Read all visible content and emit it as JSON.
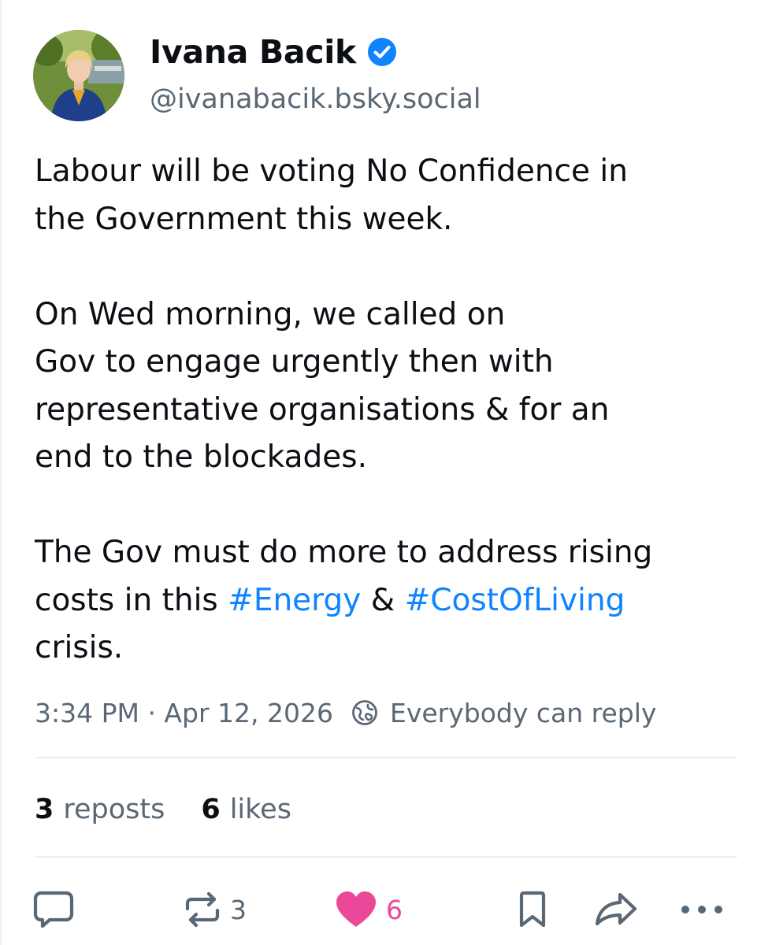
{
  "author": {
    "display_name": "Ivana Bacik",
    "handle": "@ivanabacik.bsky.social",
    "verified": true,
    "avatar_icon": "avatar-photo",
    "verified_icon": "verified-check-icon"
  },
  "post": {
    "paragraphs": [
      [
        [
          {
            "text": "Labour will be voting No Confidence in"
          }
        ],
        [
          {
            "text": "the Government this week."
          }
        ]
      ],
      [
        [
          {
            "text": "On Wed morning, we called on"
          }
        ],
        [
          {
            "text": "Gov to engage urgently then with"
          }
        ],
        [
          {
            "text": "representative organisations & for an"
          }
        ],
        [
          {
            "text": "end to the blockades."
          }
        ]
      ],
      [
        [
          {
            "text": "The Gov must do more to address rising"
          }
        ],
        [
          {
            "text": "costs in this "
          },
          {
            "text": "#Energy",
            "hashtag": true
          },
          {
            "text": " & "
          },
          {
            "text": "#CostOfLiving",
            "hashtag": true
          }
        ],
        [
          {
            "text": "crisis."
          }
        ]
      ]
    ],
    "timestamp": "3:34 PM · Apr 12, 2026",
    "reply_setting": "Everybody can reply"
  },
  "stats": {
    "reposts_count": "3",
    "reposts_label": "reposts",
    "likes_count": "6",
    "likes_label": "likes"
  },
  "actions": {
    "repost_count": "3",
    "like_count": "6",
    "liked": true
  },
  "colors": {
    "text": "#0b0f14",
    "muted": "#5a6876",
    "hashtag": "#1083fe",
    "verified": "#1083fe",
    "like": "#ec4899"
  }
}
